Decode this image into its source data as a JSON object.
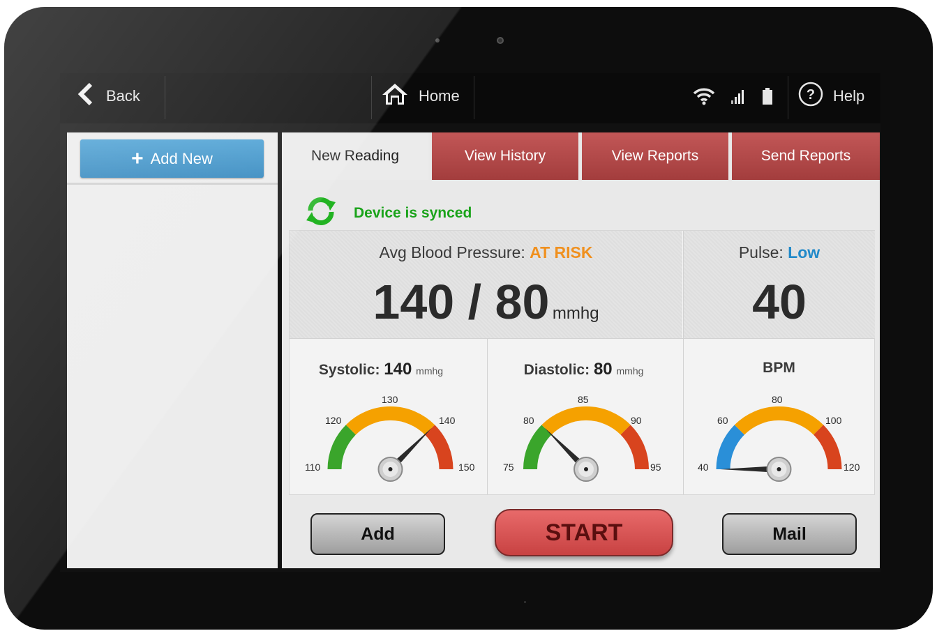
{
  "topbar": {
    "back_label": "Back",
    "home_label": "Home",
    "help_label": "Help"
  },
  "sidebar": {
    "add_new_label": "Add New"
  },
  "tabs": [
    {
      "label": "New Reading",
      "active": true
    },
    {
      "label": "View History",
      "active": false
    },
    {
      "label": "View Reports",
      "active": false
    },
    {
      "label": "Send Reports",
      "active": false
    }
  ],
  "sync": {
    "status": "Device is synced"
  },
  "bp": {
    "label": "Avg Blood Pressure:",
    "status": "AT RISK",
    "status_color": "#f0901e",
    "value": "140 / 80",
    "unit": "mmhg"
  },
  "pulse": {
    "label": "Pulse:",
    "status": "Low",
    "status_color": "#2189c9",
    "value": "40"
  },
  "gauges": [
    {
      "title": "Systolic:",
      "value_text": "140",
      "unit": "mmhg",
      "ticks": [
        "110",
        "120",
        "130",
        "140",
        "150"
      ],
      "min": 110,
      "max": 150,
      "value": 140
    },
    {
      "title": "Diastolic:",
      "value_text": "80",
      "unit": "mmhg",
      "ticks": [
        "75",
        "80",
        "85",
        "90",
        "95"
      ],
      "min": 75,
      "max": 95,
      "value": 80
    },
    {
      "title": "BPM",
      "value_text": "",
      "unit": "",
      "ticks": [
        "40",
        "60",
        "80",
        "100",
        "120"
      ],
      "min": 40,
      "max": 120,
      "value": 40
    }
  ],
  "actions": {
    "add_label": "Add",
    "start_label": "START",
    "mail_label": "Mail"
  },
  "colors": {
    "green": "#3aa52b",
    "orange": "#f5a100",
    "red": "#d8441e",
    "blue": "#2a8fd8"
  }
}
